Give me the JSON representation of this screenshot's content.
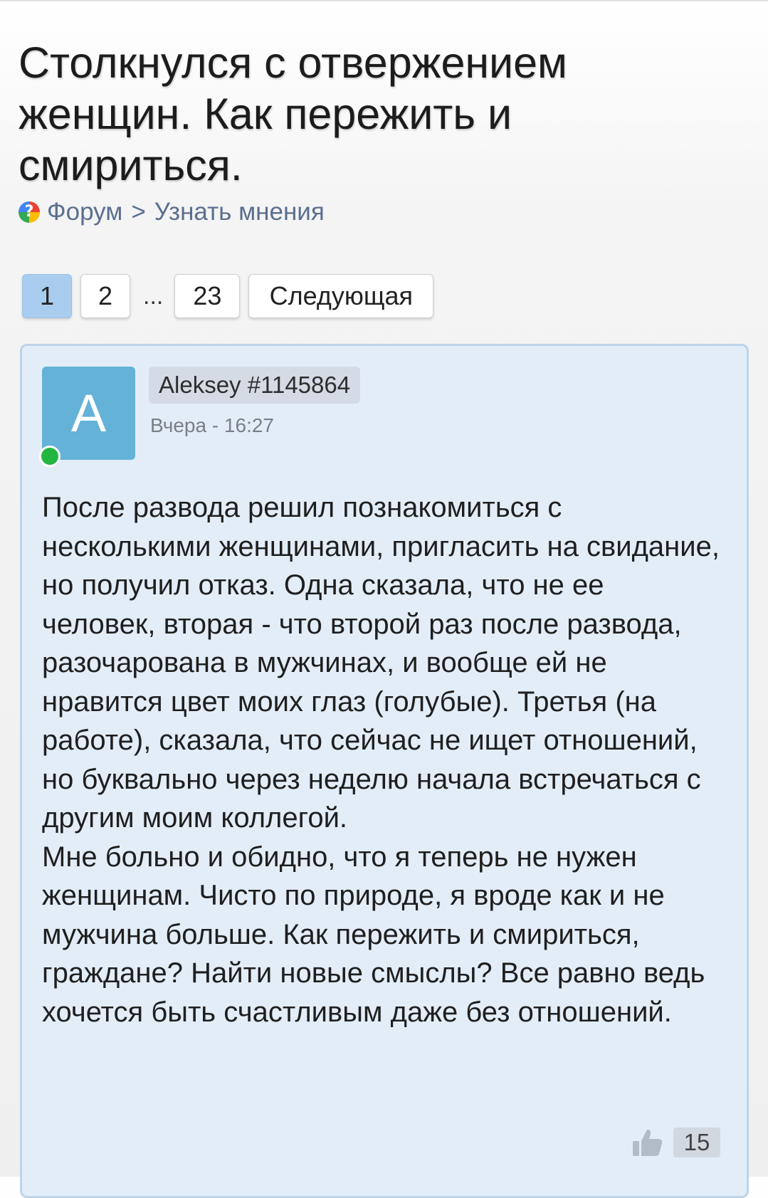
{
  "page": {
    "title": "Столкнулся с отвержением женщин. Как пережить и смириться."
  },
  "breadcrumb": {
    "icon": "forum-help-icon",
    "forum_label": "Форум",
    "separator": ">",
    "section_label": "Узнать мнения"
  },
  "pagination": {
    "current": "1",
    "page_2": "2",
    "ellipsis": "...",
    "last": "23",
    "next_label": "Следующая",
    "active_color": "#a9cdee"
  },
  "post": {
    "avatar_letter": "A",
    "avatar_color": "#64b2d8",
    "online": true,
    "author": "Aleksey #1145864",
    "time": "Вчера - 16:27",
    "body_paragraph_1": "После развода решил познакомиться с несколькими женщинами, пригласить на свидание, но получил отказ. Одна сказала, что не ее человек, вторая - что второй раз после развода, разочарована в мужчинах, и вообще ей не нравится цвет моих глаз (голубые). Третья (на работе), сказала, что сейчас не ищет отношений, но буквально через неделю начала встречаться с другим моим коллегой.",
    "body_paragraph_2": "Мне больно и обидно, что я теперь не нужен женщинам. Чисто по природе, я вроде как и не мужчина больше. Как пережить и смириться, граждане? Найти новые смыслы? Все равно ведь хочется быть счастливым даже без отношений.",
    "likes": "15",
    "like_icon": "thumbs-up-icon"
  }
}
